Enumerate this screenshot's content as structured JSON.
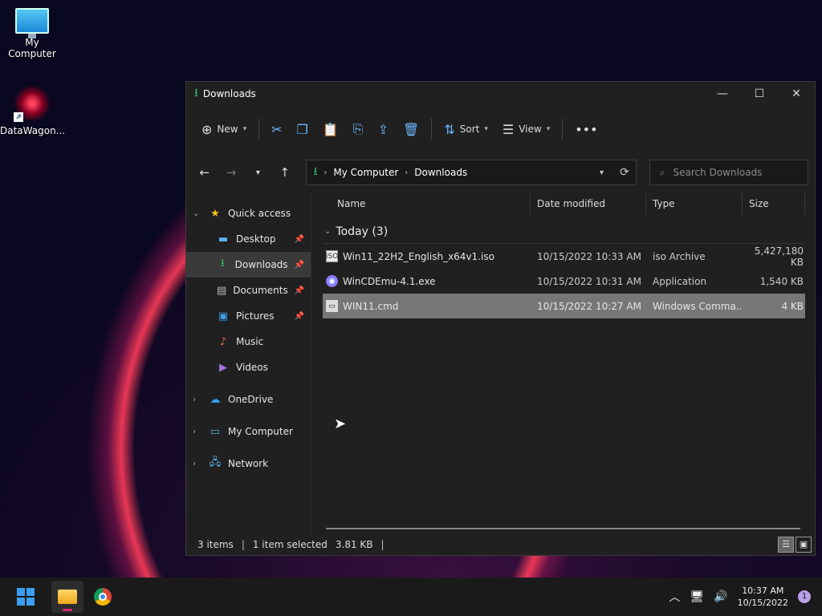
{
  "desktop": {
    "icons": [
      {
        "label": "My Computer"
      },
      {
        "label": "DataWagon..."
      }
    ]
  },
  "window": {
    "title": "Downloads",
    "controls": {
      "minimize": "—",
      "maximize": "☐",
      "close": "✕"
    }
  },
  "toolbar": {
    "new_label": "New",
    "sort_label": "Sort",
    "view_label": "View"
  },
  "address": {
    "crumbs": [
      "My Computer",
      "Downloads"
    ],
    "search_placeholder": "Search Downloads"
  },
  "sidebar": {
    "quick_access": "Quick access",
    "items": [
      {
        "label": "Desktop"
      },
      {
        "label": "Downloads"
      },
      {
        "label": "Documents"
      },
      {
        "label": "Pictures"
      },
      {
        "label": "Music"
      },
      {
        "label": "Videos"
      }
    ],
    "onedrive": "OneDrive",
    "mycomputer": "My Computer",
    "network": "Network"
  },
  "columns": {
    "name": "Name",
    "date": "Date modified",
    "type": "Type",
    "size": "Size"
  },
  "group": {
    "label": "Today (3)"
  },
  "files": [
    {
      "name": "Win11_22H2_English_x64v1.iso",
      "date": "10/15/2022 10:33 AM",
      "type": "iso Archive",
      "size": "5,427,180 KB"
    },
    {
      "name": "WinCDEmu-4.1.exe",
      "date": "10/15/2022 10:31 AM",
      "type": "Application",
      "size": "1,540 KB"
    },
    {
      "name": "WIN11.cmd",
      "date": "10/15/2022 10:27 AM",
      "type": "Windows Comma...",
      "size": "4 KB"
    }
  ],
  "status": {
    "items": "3 items",
    "selected": "1 item selected",
    "selected_size": "3.81 KB"
  },
  "taskbar": {
    "time": "10:37 AM",
    "date": "10/15/2022",
    "notifications": "1"
  }
}
